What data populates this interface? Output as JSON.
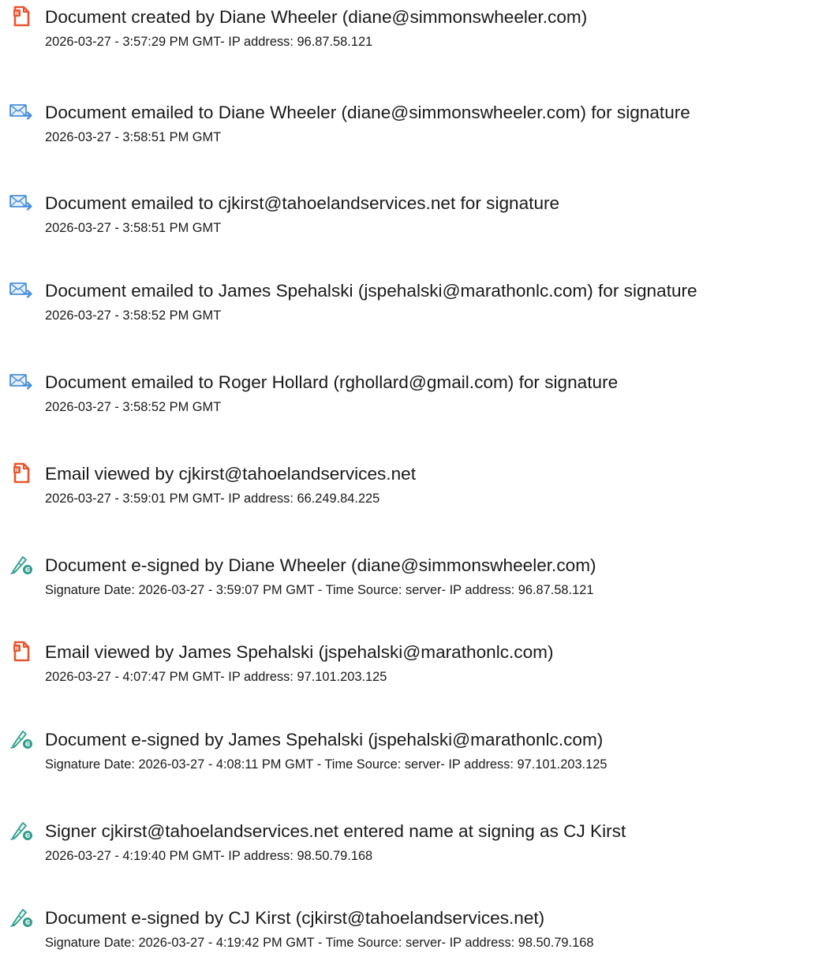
{
  "entries": [
    {
      "icon": "document-created-icon",
      "title": "Document created by Diane Wheeler (diane@simmonswheeler.com)",
      "detail": "2026-03-27 - 3:57:29 PM GMT- IP address: 96.87.58.121"
    },
    {
      "icon": "email-sent-icon",
      "title": "Document emailed to Diane Wheeler (diane@simmonswheeler.com) for signature",
      "detail": "2026-03-27 - 3:58:51 PM GMT"
    },
    {
      "icon": "email-sent-icon",
      "title": "Document emailed to cjkirst@tahoelandservices.net for signature",
      "detail": "2026-03-27 - 3:58:51 PM GMT"
    },
    {
      "icon": "email-sent-icon",
      "title": "Document emailed to James Spehalski (jspehalski@marathonlc.com) for signature",
      "detail": "2026-03-27 - 3:58:52 PM GMT"
    },
    {
      "icon": "email-sent-icon",
      "title": "Document emailed to Roger Hollard (rghollard@gmail.com) for signature",
      "detail": "2026-03-27 - 3:58:52 PM GMT"
    },
    {
      "icon": "document-viewed-icon",
      "title": "Email viewed by cjkirst@tahoelandservices.net",
      "detail": "2026-03-27 - 3:59:01 PM GMT- IP address: 66.249.84.225"
    },
    {
      "icon": "e-signature-icon",
      "title": "Document e-signed by Diane Wheeler (diane@simmonswheeler.com)",
      "detail": "Signature Date: 2026-03-27 - 3:59:07 PM GMT - Time Source: server- IP address: 96.87.58.121"
    },
    {
      "icon": "document-viewed-icon",
      "title": "Email viewed by James Spehalski (jspehalski@marathonlc.com)",
      "detail": "2026-03-27 - 4:07:47 PM GMT- IP address: 97.101.203.125"
    },
    {
      "icon": "e-signature-icon",
      "title": "Document e-signed by James Spehalski (jspehalski@marathonlc.com)",
      "detail": "Signature Date: 2026-03-27 - 4:08:11 PM GMT - Time Source: server- IP address: 97.101.203.125"
    },
    {
      "icon": "e-signature-icon",
      "title": "Signer cjkirst@tahoelandservices.net entered name at signing as CJ Kirst",
      "detail": "2026-03-27 - 4:19:40 PM GMT- IP address: 98.50.79.168"
    },
    {
      "icon": "e-signature-icon",
      "title": "Document e-signed by CJ Kirst (cjkirst@tahoelandservices.net)",
      "detail": "Signature Date: 2026-03-27 - 4:19:42 PM GMT - Time Source: server- IP address: 98.50.79.168"
    }
  ],
  "colors": {
    "document_icon": "#e8542d",
    "email_icon": "#4a90d9",
    "signature_icon": "#2e9b8c",
    "text": "#1a1a1a"
  }
}
